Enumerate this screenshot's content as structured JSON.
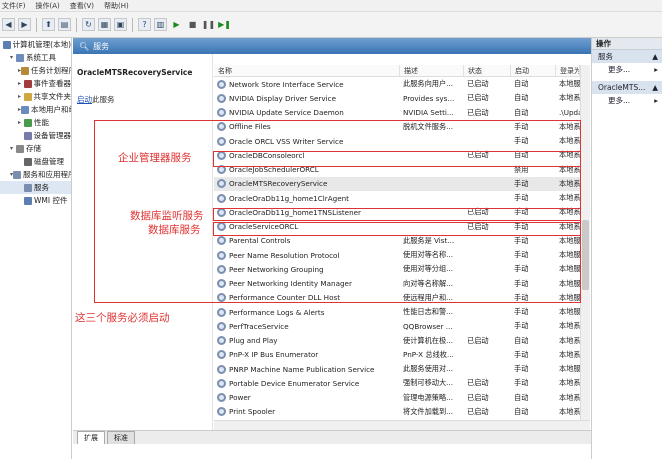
{
  "menubar": {
    "items": [
      "文件(F)",
      "操作(A)",
      "查看(V)",
      "帮助(H)"
    ]
  },
  "tree": {
    "items": [
      {
        "label": "计算机管理(本地)",
        "level": 0,
        "expander": "",
        "color": "#5b7fb0"
      },
      {
        "label": "系统工具",
        "level": 1,
        "expander": "▾",
        "color": "#6e8cbd"
      },
      {
        "label": "任务计划程序",
        "level": 2,
        "expander": "▸",
        "color": "#b58a3c"
      },
      {
        "label": "事件查看器",
        "level": 2,
        "expander": "▸",
        "color": "#a33c3c"
      },
      {
        "label": "共享文件夹",
        "level": 2,
        "expander": "▸",
        "color": "#d0a640"
      },
      {
        "label": "本地用户和组",
        "level": 2,
        "expander": "▸",
        "color": "#6a8ac0"
      },
      {
        "label": "性能",
        "level": 2,
        "expander": "▸",
        "color": "#4b9a4b"
      },
      {
        "label": "设备管理器",
        "level": 2,
        "expander": "",
        "color": "#7a7aa8"
      },
      {
        "label": "存储",
        "level": 1,
        "expander": "▾",
        "color": "#888"
      },
      {
        "label": "磁盘管理",
        "level": 2,
        "expander": "",
        "color": "#666"
      },
      {
        "label": "服务和应用程序",
        "level": 1,
        "expander": "▾",
        "color": "#7a8fb0"
      },
      {
        "label": "服务",
        "level": 2,
        "expander": "",
        "color": "#7a8fb0"
      },
      {
        "label": "WMI 控件",
        "level": 2,
        "expander": "",
        "color": "#5b7fb0"
      }
    ]
  },
  "panel": {
    "title": "服务"
  },
  "detail": {
    "service_title": "OracleMTSRecoveryService",
    "link": "启动",
    "link_suffix": "此服务"
  },
  "columns": [
    "名称",
    "描述",
    "状态",
    "启动",
    "登录为"
  ],
  "services": [
    {
      "name": "Network Store Interface Service",
      "desc": "此服务向用户...",
      "status": "已启动",
      "startup": "自动",
      "logon": "本地服务"
    },
    {
      "name": "NVIDIA Display Driver Service",
      "desc": "Provides sys...",
      "status": "已启动",
      "startup": "自动",
      "logon": "本地系统"
    },
    {
      "name": "NVIDIA Update Service Daemon",
      "desc": "NVIDIA Setti...",
      "status": "已启动",
      "startup": "自动",
      "logon": ".\\UpdatusUser"
    },
    {
      "name": "Offline Files",
      "desc": "脱机文件服务...",
      "status": "",
      "startup": "手动",
      "logon": "本地系统"
    },
    {
      "name": "Oracle ORCL VSS Writer Service",
      "desc": "",
      "status": "",
      "startup": "手动",
      "logon": "本地系统"
    },
    {
      "name": "OracleDBConsoleorcl",
      "desc": "",
      "status": "已启动",
      "startup": "自动",
      "logon": "本地系统"
    },
    {
      "name": "OracleJobSchedulerORCL",
      "desc": "",
      "status": "",
      "startup": "禁用",
      "logon": "本地系统"
    },
    {
      "name": "OracleMTSRecoveryService",
      "desc": "",
      "status": "",
      "startup": "手动",
      "logon": "本地系统"
    },
    {
      "name": "OracleOraDb11g_home1ClrAgent",
      "desc": "",
      "status": "",
      "startup": "手动",
      "logon": "本地系统"
    },
    {
      "name": "OracleOraDb11g_home1TNSListener",
      "desc": "",
      "status": "已启动",
      "startup": "手动",
      "logon": "本地系统"
    },
    {
      "name": "OracleServiceORCL",
      "desc": "",
      "status": "已启动",
      "startup": "手动",
      "logon": "本地系统"
    },
    {
      "name": "Parental Controls",
      "desc": "此服务是 Vist...",
      "status": "",
      "startup": "手动",
      "logon": "本地服务"
    },
    {
      "name": "Peer Name Resolution Protocol",
      "desc": "使用对等名称...",
      "status": "",
      "startup": "手动",
      "logon": "本地服务"
    },
    {
      "name": "Peer Networking Grouping",
      "desc": "使用对等分组...",
      "status": "",
      "startup": "手动",
      "logon": "本地服务"
    },
    {
      "name": "Peer Networking Identity Manager",
      "desc": "向对等名称解...",
      "status": "",
      "startup": "手动",
      "logon": "本地服务"
    },
    {
      "name": "Performance Counter DLL Host",
      "desc": "使远程用户和...",
      "status": "",
      "startup": "手动",
      "logon": "本地服务"
    },
    {
      "name": "Performance Logs & Alerts",
      "desc": "性能日志和警...",
      "status": "",
      "startup": "手动",
      "logon": "本地服务"
    },
    {
      "name": "PerfTraceService",
      "desc": "QQBrowser ...",
      "status": "",
      "startup": "手动",
      "logon": "本地系统"
    },
    {
      "name": "Plug and Play",
      "desc": "使计算机在极...",
      "status": "已启动",
      "startup": "自动",
      "logon": "本地系统"
    },
    {
      "name": "PnP-X IP Bus Enumerator",
      "desc": "PnP-X 总线枚...",
      "status": "",
      "startup": "手动",
      "logon": "本地系统"
    },
    {
      "name": "PNRP Machine Name Publication Service",
      "desc": "此服务使用对...",
      "status": "",
      "startup": "手动",
      "logon": "本地服务"
    },
    {
      "name": "Portable Device Enumerator Service",
      "desc": "强制可移动大...",
      "status": "已启动",
      "startup": "手动",
      "logon": "本地系统"
    },
    {
      "name": "Power",
      "desc": "管理电源策略...",
      "status": "已启动",
      "startup": "自动",
      "logon": "本地系统"
    },
    {
      "name": "Print Spooler",
      "desc": "将文件加载到...",
      "status": "已启动",
      "startup": "自动",
      "logon": "本地系统"
    }
  ],
  "tabs": [
    "扩展",
    "标准"
  ],
  "actions": {
    "header": "操作",
    "sections": [
      {
        "title": "服务",
        "more": "更多..."
      },
      {
        "title": "OracleMTS...",
        "more": "更多..."
      }
    ]
  },
  "annotations": {
    "enterprise": "企业管理器服务",
    "listener": "数据库监听服务",
    "database": "数据库服务",
    "must_start": "这三个服务必须启动"
  },
  "colors": {
    "annotation": "#e03232",
    "header": "#3a74b4"
  }
}
